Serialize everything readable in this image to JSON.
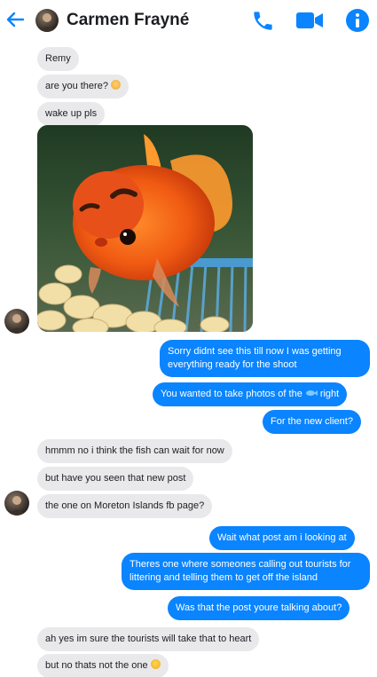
{
  "header": {
    "contact_name": "Carmen Frayné",
    "back_icon": "arrow-left-icon",
    "call_icon": "phone-icon",
    "video_icon": "video-camera-icon",
    "info_icon": "info-icon",
    "accent_color": "#0a84ff"
  },
  "messages": {
    "m1": "Remy",
    "m2": "are you there?",
    "m3": "wake up pls",
    "m4_photo": "goldfish-photo",
    "m5": "Sorry didnt see this till now I was getting everything ready for the shoot",
    "m6a": "You wanted to take photos of the",
    "m6b": "right",
    "m7": "For the new client?",
    "m8": "hmmm no i think the fish can wait for now",
    "m9": "but have you seen that new post",
    "m10": "the one on Moreton Islands fb page?",
    "m11": "Wait what post am i looking at",
    "m12": "Theres one where someones calling out tourists for littering and telling them to get off the island",
    "m13": "Was that the post youre talking about?",
    "m14": "ah yes im sure the tourists will take that to heart",
    "m15": "but no thats not the one"
  },
  "colors": {
    "incoming_bubble": "#e9e9eb",
    "outgoing_bubble": "#0a84ff"
  }
}
